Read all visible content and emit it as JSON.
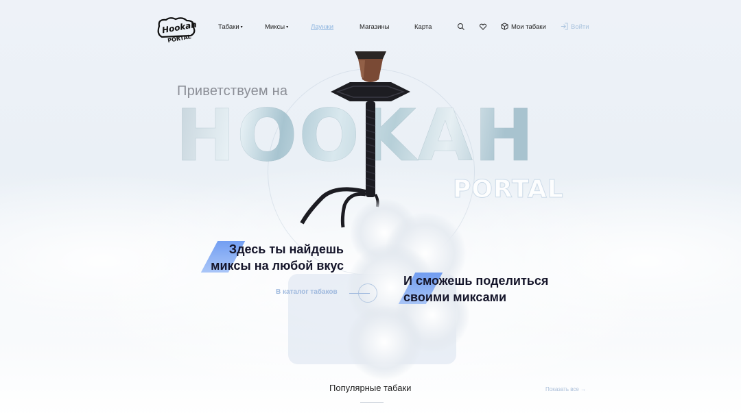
{
  "logo": {
    "line1": "Hookah",
    "line2": "PORTAL"
  },
  "nav": {
    "items": [
      {
        "label": "Табаки",
        "caret": "▾"
      },
      {
        "label": "Миксы",
        "caret": "▾"
      },
      {
        "label": "Лаунжи"
      },
      {
        "label": "Магазины"
      },
      {
        "label": "Карта"
      }
    ],
    "my_tobaccos": "Мои табаки",
    "login": "Войти"
  },
  "hero": {
    "welcome": "Приветствуем на",
    "big_word": "HOOKAH",
    "sub_word": "PORTAL",
    "tagline_left": [
      "Здесь ты найдешь",
      "миксы на любой вкус"
    ],
    "tagline_right": [
      "И сможешь поделиться",
      "своими миксами"
    ],
    "catalog_link": "В каталог табаков"
  },
  "popular": {
    "title": "Популярные табаки",
    "show_all": "Показать все →"
  },
  "colors": {
    "accent": "#5b8ef0",
    "link": "#9fb9de",
    "text": "#15152a"
  }
}
